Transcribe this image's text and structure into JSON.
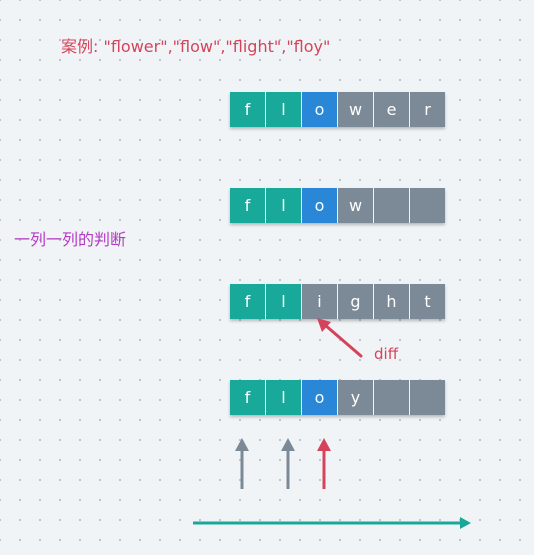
{
  "title": "案例: \"flower\",\"flow\",\"flight\",\"floy\"",
  "side_label": "一列一列的判断",
  "diff_label": "diff",
  "colors": {
    "match": "#19a99a",
    "current": "#2a86d6",
    "other": "#7c8a98",
    "scan_arrow": "#1aa79a",
    "diff_arrow": "#d5435a",
    "done_arrow": "#7c8a98"
  },
  "rows": [
    {
      "cells": [
        {
          "ch": "f",
          "state": "match"
        },
        {
          "ch": "l",
          "state": "match"
        },
        {
          "ch": "o",
          "state": "current"
        },
        {
          "ch": "w",
          "state": "other"
        },
        {
          "ch": "e",
          "state": "other"
        },
        {
          "ch": "r",
          "state": "other"
        }
      ]
    },
    {
      "cells": [
        {
          "ch": "f",
          "state": "match"
        },
        {
          "ch": "l",
          "state": "match"
        },
        {
          "ch": "o",
          "state": "current"
        },
        {
          "ch": "w",
          "state": "other"
        },
        {
          "ch": "",
          "state": "other"
        },
        {
          "ch": "",
          "state": "other"
        }
      ]
    },
    {
      "cells": [
        {
          "ch": "f",
          "state": "match"
        },
        {
          "ch": "l",
          "state": "match"
        },
        {
          "ch": "i",
          "state": "other"
        },
        {
          "ch": "g",
          "state": "other"
        },
        {
          "ch": "h",
          "state": "other"
        },
        {
          "ch": "t",
          "state": "other"
        }
      ]
    },
    {
      "cells": [
        {
          "ch": "f",
          "state": "match"
        },
        {
          "ch": "l",
          "state": "match"
        },
        {
          "ch": "o",
          "state": "current"
        },
        {
          "ch": "y",
          "state": "other"
        },
        {
          "ch": "",
          "state": "other"
        },
        {
          "ch": "",
          "state": "other"
        }
      ]
    }
  ]
}
